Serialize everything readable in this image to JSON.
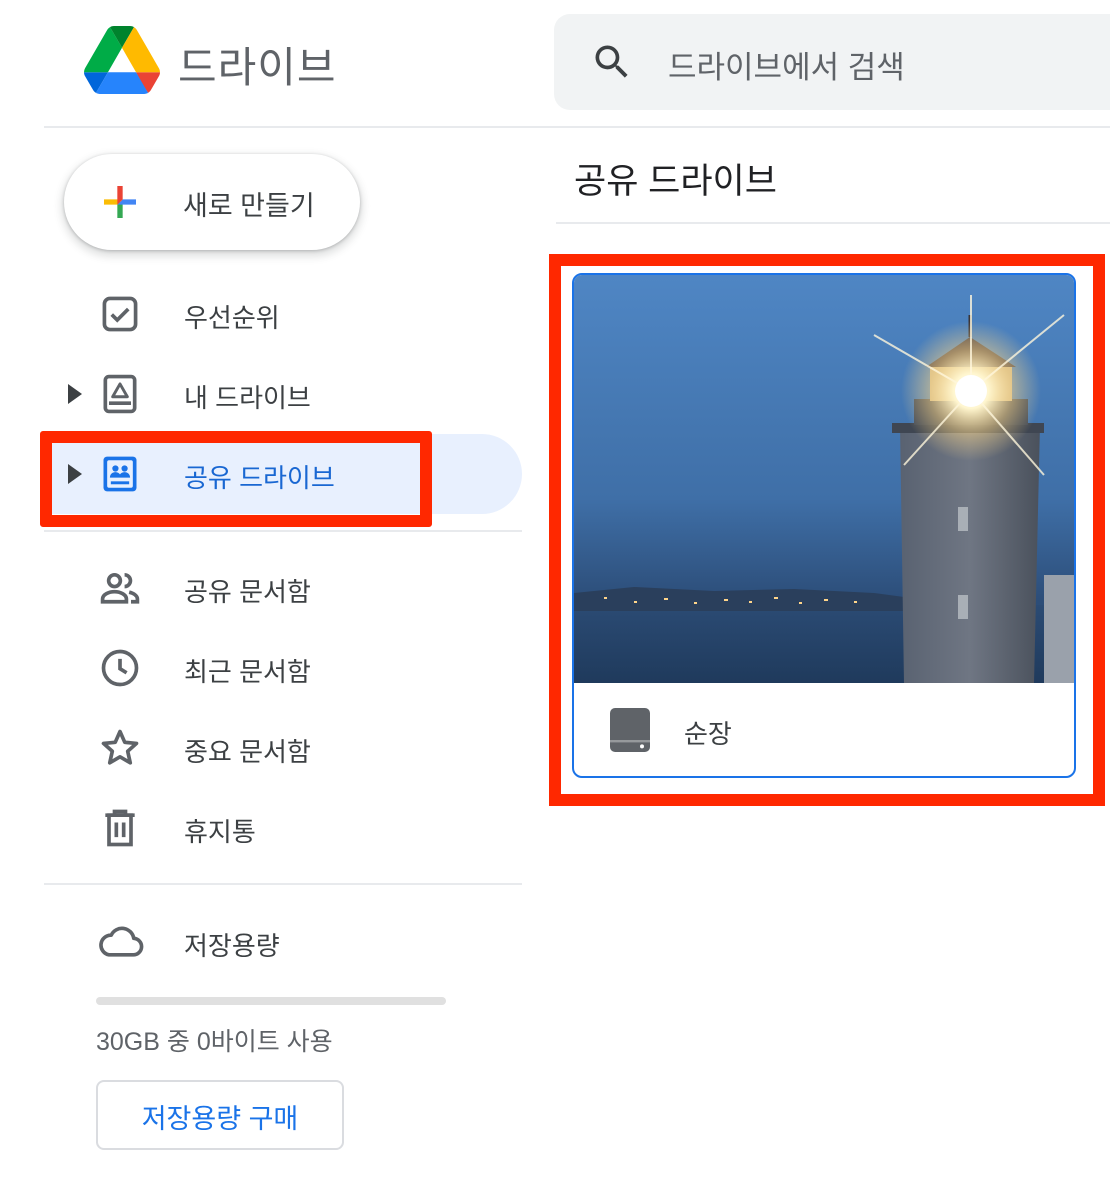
{
  "header": {
    "app_title": "드라이브",
    "search_placeholder": "드라이브에서 검색"
  },
  "sidebar": {
    "new_button_label": "새로 만들기",
    "items": [
      {
        "label": "우선순위",
        "icon": "priority-check-icon"
      },
      {
        "label": "내 드라이브",
        "icon": "my-drive-icon"
      },
      {
        "label": "공유 드라이브",
        "icon": "shared-drives-icon",
        "active": true
      },
      {
        "label": "공유 문서함",
        "icon": "shared-with-me-icon"
      },
      {
        "label": "최근 문서함",
        "icon": "clock-icon"
      },
      {
        "label": "중요 문서함",
        "icon": "star-icon"
      },
      {
        "label": "휴지통",
        "icon": "trash-icon"
      },
      {
        "label": "저장용량",
        "icon": "cloud-icon"
      }
    ],
    "storage": {
      "usage_text": "30GB 중 0바이트 사용",
      "used_fraction": 0,
      "buy_button_label": "저장용량 구매"
    }
  },
  "main": {
    "title": "공유 드라이브",
    "drives": [
      {
        "name": "순장",
        "thumbnail": "lighthouse-at-dusk"
      }
    ]
  },
  "colors": {
    "accent": "#1a73e8",
    "active_bg": "#e8f0fe",
    "annotation_red": "#ff2800"
  }
}
